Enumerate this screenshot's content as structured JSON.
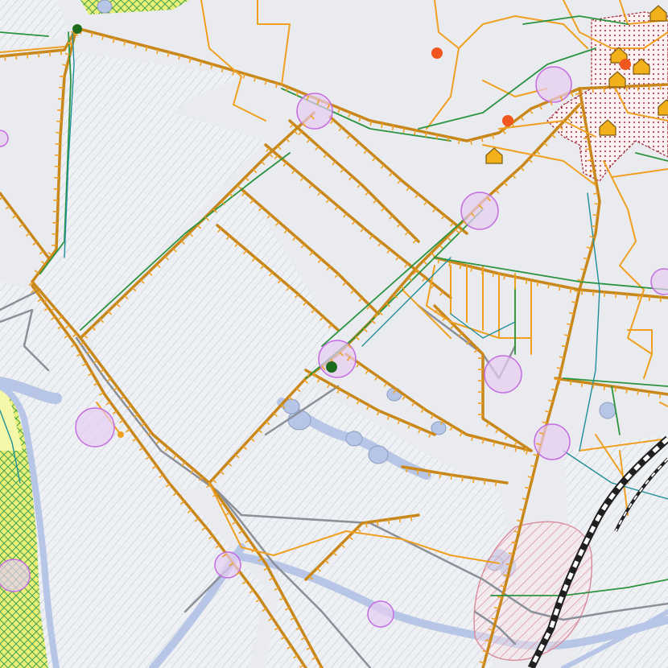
{
  "map": {
    "kind": "utility network map (water/gas pipelines, settlement plan)",
    "colors": {
      "background": "#e9ebef",
      "hatch_light": "#c9d2de",
      "water_pipe": "#f0a020",
      "main_pipe": "#c8871a",
      "sewer_pipe": "#2b9440",
      "power_pipe": "#1f8f9a",
      "road": "#8a8f98",
      "river": "#b7c6e6",
      "buffer_zone_fill": "#e7cdf2",
      "buffer_zone_stroke": "#c46ee0",
      "protected_hatch": "#d98b9a",
      "green_zone": "#e9ef6a",
      "dense_settlement": "#a3283a",
      "railway_dark": "#202020",
      "building_icon": "#f2b11a",
      "red_point": "#f0561e",
      "green_point": "#1e6b1e"
    },
    "icons": {
      "building": "house-pentagon-icon",
      "point": "circle-point-icon",
      "buffer": "buffer-circle-icon"
    }
  }
}
